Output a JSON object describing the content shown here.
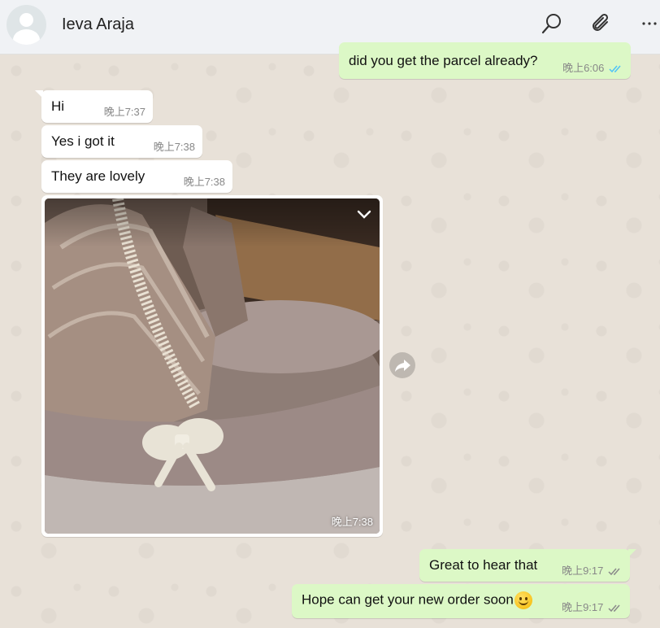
{
  "header": {
    "contact_name": "Ieva Araja",
    "icons": [
      "search-icon",
      "attach-icon",
      "menu-icon"
    ]
  },
  "messages": [
    {
      "dir": "out",
      "text": "did you get the parcel already?",
      "time": "晚上6:06",
      "status": "read"
    },
    {
      "dir": "in",
      "text": "Hi",
      "time": "晚上7:37"
    },
    {
      "dir": "in",
      "text": "Yes i got it",
      "time": "晚上7:38"
    },
    {
      "dir": "in",
      "text": "They are lovely",
      "time": "晚上7:38"
    },
    {
      "dir": "in",
      "type": "image",
      "time": "晚上7:38"
    },
    {
      "dir": "out",
      "text": "Great to hear that",
      "time": "晚上9:17",
      "status": "delivered"
    },
    {
      "dir": "out",
      "text": "Hope can get your new order soon",
      "time": "晚上9:17",
      "status": "delivered",
      "emoji": "slightly-smiling-face"
    }
  ],
  "colors": {
    "outgoing_bubble": "#dcf8c6",
    "incoming_bubble": "#ffffff",
    "read_tick": "#4fc3f7",
    "delivered_tick": "#8a8a8a"
  }
}
